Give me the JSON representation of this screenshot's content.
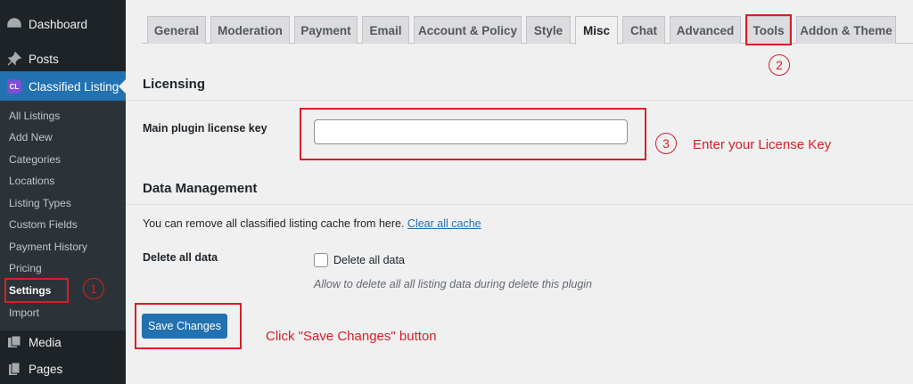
{
  "sidebar": {
    "top_items": [
      {
        "label": "Dashboard",
        "icon": "dashboard-icon"
      },
      {
        "label": "Posts",
        "icon": "pin-icon"
      },
      {
        "label": "Classified Listing",
        "icon": "classified-listing-logo-icon",
        "badge": "CL"
      }
    ],
    "sub_items": [
      "All Listings",
      "Add New",
      "Categories",
      "Locations",
      "Listing Types",
      "Custom Fields",
      "Payment History",
      "Pricing",
      "Settings",
      "Import"
    ],
    "current_sub": "Settings",
    "bottom_items": [
      {
        "label": "Media",
        "icon": "media-icon"
      },
      {
        "label": "Pages",
        "icon": "pages-icon"
      }
    ]
  },
  "tabs": [
    "General",
    "Moderation",
    "Payment",
    "Email",
    "Account & Policy",
    "Style",
    "Misc",
    "Chat",
    "Advanced",
    "Tools",
    "Addon & Theme"
  ],
  "active_tab": "Misc",
  "licensing": {
    "title": "Licensing",
    "license_label": "Main plugin license key",
    "license_value": ""
  },
  "data_management": {
    "title": "Data Management",
    "cache_text": "You can remove all classified listing cache from here.",
    "cache_link": "Clear all cache",
    "delete_label": "Delete all data",
    "checkbox_label": "Delete all data",
    "checkbox_checked": false,
    "delete_desc": "Allow to delete all all listing data during delete this plugin"
  },
  "save_button": "Save Changes",
  "annotations": {
    "step1": "1",
    "step2": "2",
    "step3": "3",
    "license_note": "Enter your License Key",
    "save_note": "Click \"Save Changes\" button"
  },
  "colors": {
    "sidebar_bg": "#1d2327",
    "accent": "#2271b1",
    "annotation": "#d61f26"
  }
}
